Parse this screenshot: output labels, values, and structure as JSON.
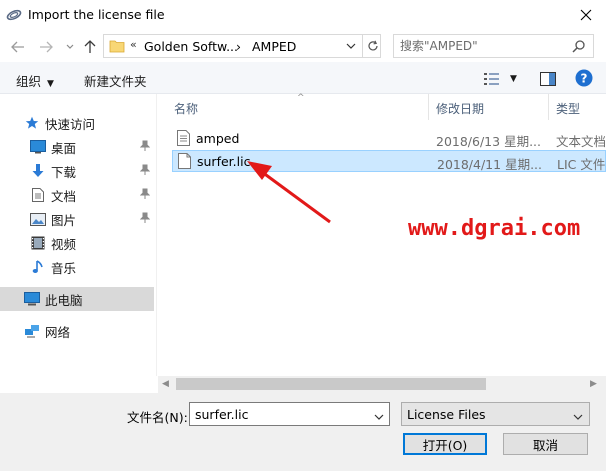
{
  "window": {
    "title": "Import the license file"
  },
  "address": {
    "overflow": "«",
    "crumb1": "Golden Softw...",
    "crumb2": "AMPED"
  },
  "search": {
    "placeholder": "搜索\"AMPED\""
  },
  "toolbar": {
    "organize": "组织",
    "new_folder": "新建文件夹"
  },
  "sidebar": {
    "quick_access": "快速访问",
    "items": [
      {
        "label": "桌面",
        "icon": "desktop-icon",
        "pinned": true
      },
      {
        "label": "下载",
        "icon": "download-icon",
        "pinned": true
      },
      {
        "label": "文档",
        "icon": "document-icon",
        "pinned": true
      },
      {
        "label": "图片",
        "icon": "picture-icon",
        "pinned": true
      },
      {
        "label": "视频",
        "icon": "video-icon",
        "pinned": false
      },
      {
        "label": "音乐",
        "icon": "music-icon",
        "pinned": false
      }
    ],
    "this_pc": "此电脑",
    "network": "网络"
  },
  "columns": {
    "name": "名称",
    "modified": "修改日期",
    "type": "类型"
  },
  "files": [
    {
      "name": "amped",
      "date": "2018/6/13 星期...",
      "type": "文本文档",
      "selected": false
    },
    {
      "name": "surfer.lic",
      "date": "2018/4/11 星期...",
      "type": "LIC 文件",
      "selected": true
    }
  ],
  "watermark": "www.dgrai.com",
  "footer": {
    "filename_label": "文件名(N):",
    "filename_value": "surfer.lic",
    "filter_value": "License Files",
    "open": "打开(O)",
    "cancel": "取消"
  },
  "colors": {
    "accent": "#0078d7",
    "selection": "#cce8ff",
    "annotation": "#e21919"
  }
}
